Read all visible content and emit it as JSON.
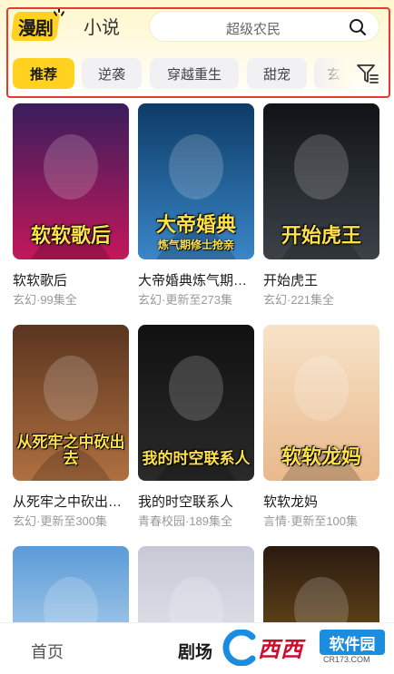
{
  "header": {
    "logo_text": "漫剧",
    "novel_tab": "小说",
    "search_placeholder": "超级农民"
  },
  "categories": [
    {
      "label": "推荐",
      "active": true
    },
    {
      "label": "逆袭",
      "active": false
    },
    {
      "label": "穿越重生",
      "active": false
    },
    {
      "label": "甜宠",
      "active": false
    },
    {
      "label": "玄",
      "active": false
    }
  ],
  "items": [
    {
      "title": "软软歌后",
      "meta": "玄幻·99集全",
      "cover_text": "软软歌后",
      "palette": [
        "#3a1d5c",
        "#c2185b"
      ]
    },
    {
      "title": "大帝婚典炼气期…",
      "meta": "玄幻·更新至273集",
      "cover_text": "大帝婚典",
      "cover_sub": "炼气期修士抢亲",
      "palette": [
        "#0d3b66",
        "#3a86c8"
      ]
    },
    {
      "title": "开始虎王",
      "meta": "玄幻·221集全",
      "cover_text": "开始虎王",
      "palette": [
        "#101418",
        "#3c4248"
      ]
    },
    {
      "title": "从死牢之中砍出…",
      "meta": "玄幻·更新至300集",
      "cover_text": "从死牢之中砍出去",
      "palette": [
        "#5a3520",
        "#b07040"
      ]
    },
    {
      "title": "我的时空联系人",
      "meta": "青春校园·189集全",
      "cover_text": "我的时空联系人",
      "palette": [
        "#111111",
        "#2a2a2a"
      ]
    },
    {
      "title": "软软龙妈",
      "meta": "言情·更新至100集",
      "cover_text": "软软龙妈",
      "palette": [
        "#f7e3c8",
        "#e9b98c"
      ]
    },
    {
      "title": "",
      "meta": "",
      "cover_text": "",
      "palette": [
        "#5a9bd8",
        "#d8e6f2"
      ]
    },
    {
      "title": "",
      "meta": "",
      "cover_text": "",
      "palette": [
        "#c7c9d6",
        "#eceef4"
      ]
    },
    {
      "title": "",
      "meta": "",
      "cover_text": "",
      "palette": [
        "#2a1a10",
        "#8a6420"
      ]
    }
  ],
  "bottom_nav": {
    "home": "首页",
    "theater": "剧场"
  },
  "watermark": {
    "text": "西西",
    "badge": "软件园",
    "sub": "CR173.COM"
  }
}
